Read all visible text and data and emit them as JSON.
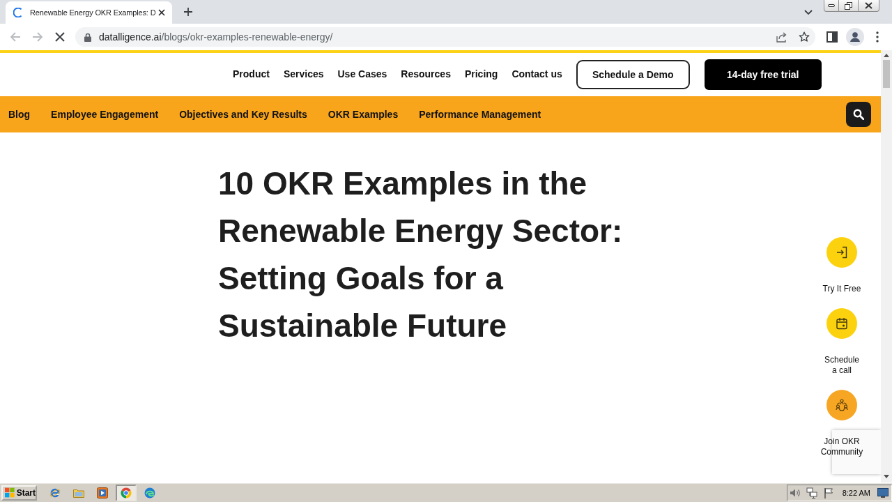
{
  "browser": {
    "tab": {
      "title": "Renewable Energy OKR Examples: D",
      "loading": true
    },
    "back": {
      "disabled": true
    },
    "forward": {
      "disabled": true
    },
    "address": {
      "host": "datalligence.ai",
      "path": "/blogs/okr-examples-renewable-energy/"
    }
  },
  "header": {
    "nav": [
      "Product",
      "Services",
      "Use Cases",
      "Resources",
      "Pricing",
      "Contact us"
    ],
    "buttons": [
      {
        "label": "Schedule a Demo",
        "kind": "outline"
      },
      {
        "label": "14-day free trial",
        "kind": "filled"
      }
    ]
  },
  "category_bar": {
    "items": [
      "Blog",
      "Employee Engagement",
      "Objectives and Key Results",
      "OKR Examples",
      "Performance Management"
    ]
  },
  "article": {
    "title": "10 OKR Examples in the Renewable Energy Sector: Setting Goals for a Sustainable Future"
  },
  "side_actions": [
    {
      "label": "Try It Free",
      "kind": "sign-in",
      "color": "#fcd20f"
    },
    {
      "label": "Schedule\na call",
      "kind": "calendar",
      "color": "#fcd20f"
    },
    {
      "label": "Join OKR\nCommunity",
      "kind": "community",
      "color": "#f6a623"
    }
  ],
  "taskbar": {
    "start": "Start",
    "apps": [
      {
        "kind": "ie",
        "selected": false
      },
      {
        "kind": "folder",
        "selected": false
      },
      {
        "kind": "media",
        "selected": false
      },
      {
        "kind": "chrome",
        "selected": true
      },
      {
        "kind": "edge",
        "selected": false
      }
    ],
    "clock": "8:22 AM"
  }
}
